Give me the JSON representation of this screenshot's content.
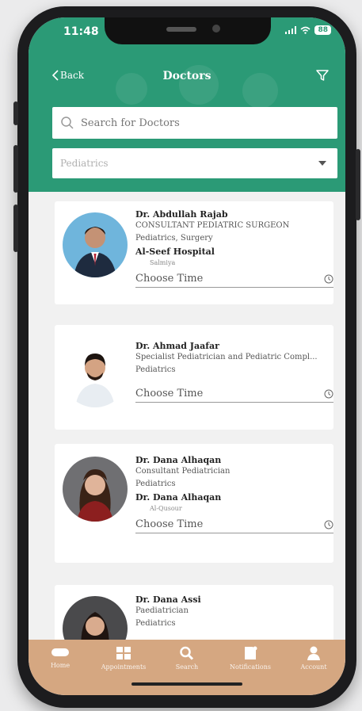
{
  "status_bar": {
    "time": "11:48",
    "battery": "88"
  },
  "nav": {
    "back_label": "Back",
    "title": "Doctors"
  },
  "search": {
    "placeholder": "Search for Doctors"
  },
  "specialty_select": {
    "value": "Pediatrics"
  },
  "doctors": [
    {
      "name": "Dr. Abdullah Rajab",
      "title": "CONSULTANT PEDIATRIC SURGEON",
      "specialties": "Pediatrics, Surgery",
      "hospital": "Al-Seef Hospital",
      "area": "Salmiya",
      "choose_time": "Choose Time"
    },
    {
      "name": "Dr. Ahmad Jaafar",
      "title": "Specialist Pediatrician and Pediatric Compl...",
      "specialties": "Pediatrics",
      "choose_time": "Choose Time"
    },
    {
      "name": "Dr. Dana Alhaqan",
      "title": "Consultant Pediatrician",
      "specialties": "Pediatrics",
      "hospital": "Dr. Dana Alhaqan",
      "area": "Al-Qusour",
      "choose_time": "Choose Time"
    },
    {
      "name": "Dr. Dana Assi",
      "title": "Paediatrician",
      "specialties": "Pediatrics"
    }
  ],
  "tabbar": [
    {
      "label": "Home",
      "icon": "home-icon"
    },
    {
      "label": "Appointments",
      "icon": "appointments-icon"
    },
    {
      "label": "Search",
      "icon": "search-icon"
    },
    {
      "label": "Notifications",
      "icon": "notifications-icon"
    },
    {
      "label": "Account",
      "icon": "account-icon"
    }
  ],
  "colors": {
    "header": "#2b9a76",
    "tabbar": "#d5a781",
    "background": "#f1f1f1"
  }
}
